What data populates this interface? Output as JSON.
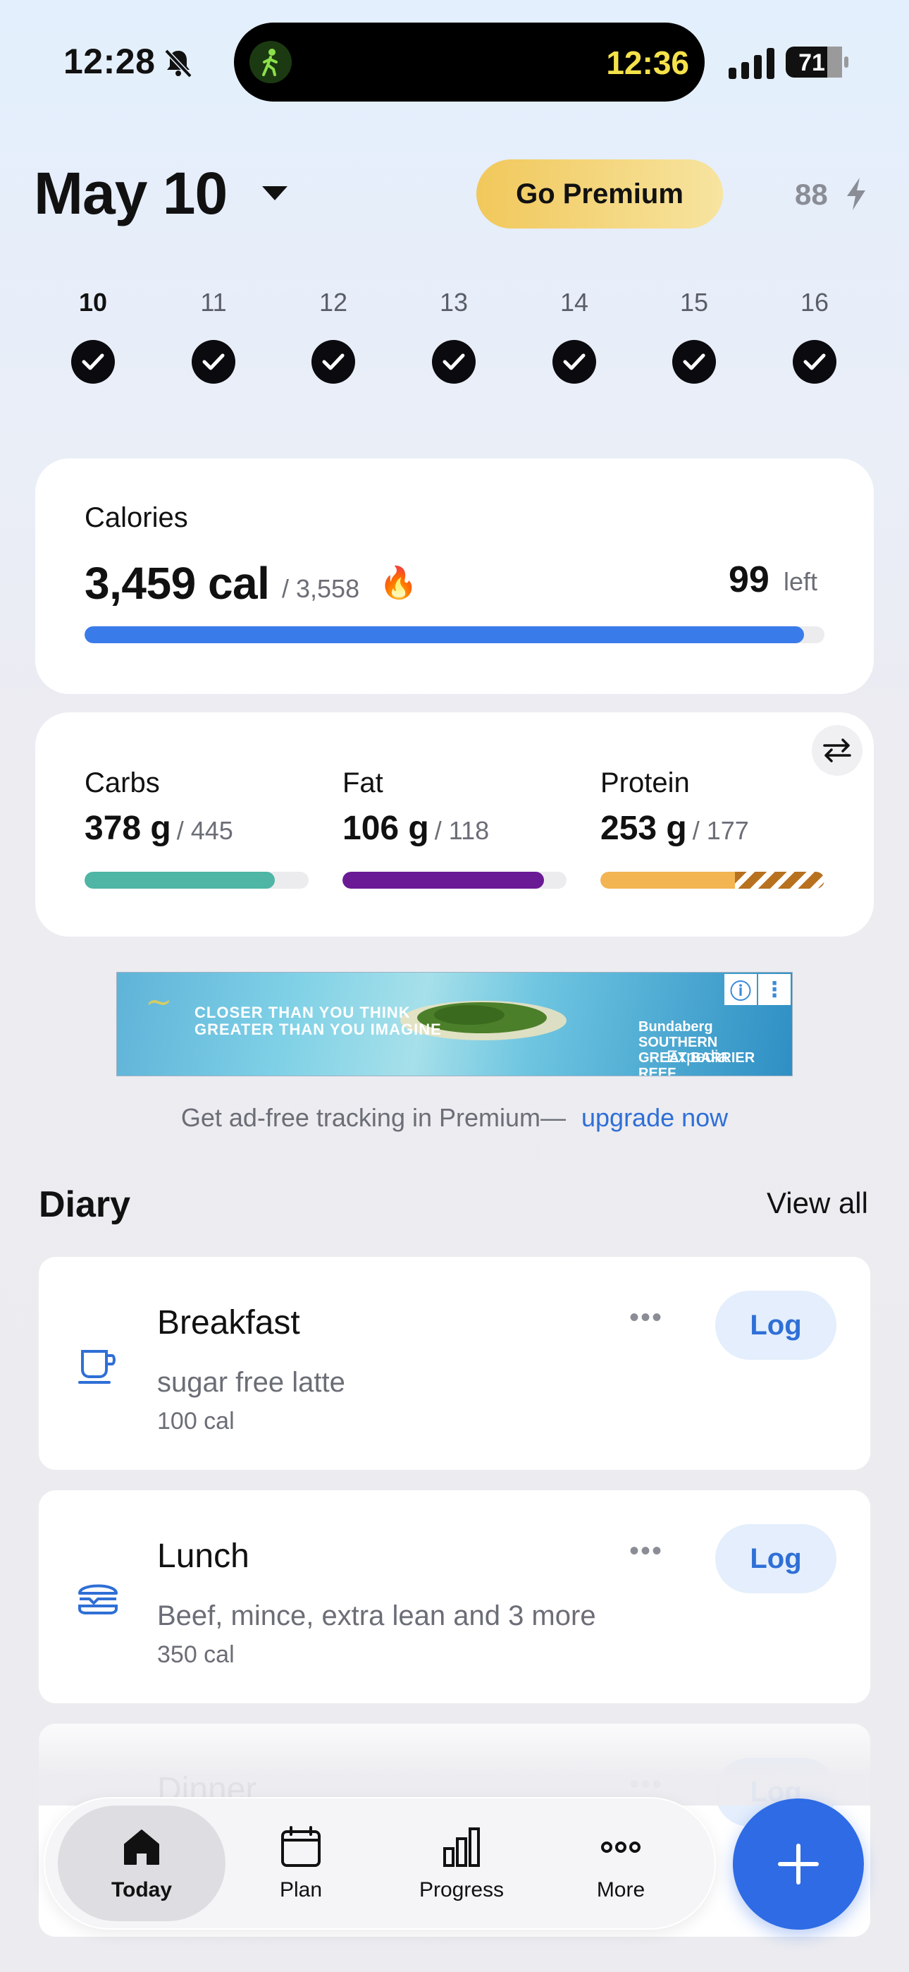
{
  "status_bar": {
    "time": "12:28",
    "island_time": "12:36",
    "battery": "71"
  },
  "header": {
    "date": "May 10",
    "premium_label": "Go Premium",
    "streak_count": "88"
  },
  "week": [
    {
      "day": "10",
      "completed": true,
      "active": true
    },
    {
      "day": "11",
      "completed": true
    },
    {
      "day": "12",
      "completed": true
    },
    {
      "day": "13",
      "completed": true
    },
    {
      "day": "14",
      "completed": true
    },
    {
      "day": "15",
      "completed": true
    },
    {
      "day": "16",
      "completed": true
    }
  ],
  "calories": {
    "label": "Calories",
    "consumed": "3,459 cal",
    "goal": "/ 3,558",
    "left_value": "99",
    "left_label": "left",
    "progress": 0.972,
    "bar_color": "#3a7bea"
  },
  "macros": [
    {
      "name": "Carbs",
      "value": "378 g",
      "goal": "/ 445",
      "progress": 0.85,
      "color": "#4fb5a5"
    },
    {
      "name": "Fat",
      "value": "106 g",
      "goal": "/ 118",
      "progress": 0.9,
      "color": "#6a1a95"
    },
    {
      "name": "Protein",
      "value": "253 g",
      "goal": "/ 177",
      "progress": 0.6,
      "over_progress": 0.4,
      "color": "#f2b552"
    }
  ],
  "ad": {
    "line1": "CLOSER THAN YOU THINK",
    "line2": "GREATER THAN YOU IMAGINE",
    "brand": "Bundaberg SOUTHERN GREAT BARRIER REEF",
    "partner": "Expedia"
  },
  "upgrade": {
    "text": "Get ad-free tracking in Premium—",
    "link": "upgrade now"
  },
  "diary": {
    "title": "Diary",
    "view_all": "View all",
    "meals": [
      {
        "name": "Breakfast",
        "items": "sugar free latte",
        "calories": "100 cal",
        "log_label": "Log",
        "icon": "coffee-cup-icon"
      },
      {
        "name": "Lunch",
        "items": "Beef, mince, extra lean and 3 more",
        "calories": "350 cal",
        "log_label": "Log",
        "icon": "burger-icon"
      },
      {
        "name": "Dinner",
        "items": "",
        "calories": "",
        "log_label": "Log",
        "icon": "dinner-icon"
      }
    ]
  },
  "nav": {
    "tabs": [
      {
        "label": "Today",
        "icon": "home-icon",
        "active": true
      },
      {
        "label": "Plan",
        "icon": "calendar-icon"
      },
      {
        "label": "Progress",
        "icon": "bar-chart-icon"
      },
      {
        "label": "More",
        "icon": "more-dots-icon"
      }
    ],
    "fab_icon": "plus-icon"
  }
}
